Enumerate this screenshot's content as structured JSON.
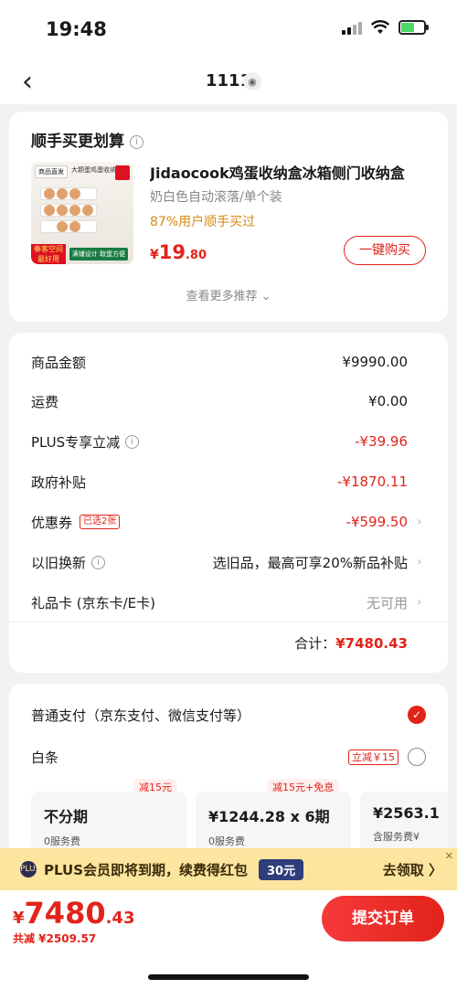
{
  "status_bar": {
    "time": "19:48"
  },
  "nav": {
    "title": "1111"
  },
  "upsell": {
    "section_title": "顺手买更划算",
    "thumb": {
      "top_tag": "商品直发",
      "top_text": "大颗蛋鸡蛋收纳盒",
      "left_tag": "秦客空间 最好用",
      "right_tag": "满铺设计 取蛋方便"
    },
    "product_name": "Jidaocook鸡蛋收纳盒冰箱侧门收纳盒",
    "product_spec": "奶白色自动滚落/单个装",
    "buyer_stat": "87%用户顺手买过",
    "price_symbol": "¥",
    "price_int": "19",
    "price_dec": ".80",
    "buy_label": "一键购买",
    "more_label": "查看更多推荐"
  },
  "summary": {
    "goods_label": "商品金额",
    "goods_value": "¥9990.00",
    "shipping_label": "运费",
    "shipping_value": "¥0.00",
    "plus_label": "PLUS专享立减",
    "plus_value": "-¥39.96",
    "gov_label": "政府补贴",
    "gov_value": "-¥1870.11",
    "coupon_label": "优惠券",
    "coupon_tag": "已选2张",
    "coupon_value": "-¥599.50",
    "tradein_label": "以旧换新",
    "tradein_value": "选旧品，最高可享20%新品补贴",
    "giftcard_label": "礼品卡 (京东卡/E卡)",
    "giftcard_value": "无可用",
    "total_label": "合计：",
    "total_value": "¥7480.43"
  },
  "payment": {
    "normal_label": "普通支付（京东支付、微信支付等）",
    "baitiao_label": "白条",
    "baitiao_tag": "立减￥15",
    "plans": [
      {
        "badge": "减15元",
        "title": "不分期",
        "sub": "0服务费"
      },
      {
        "badge": "减15元+免息",
        "title": "¥1244.28 x 6期",
        "sub": "0服务费"
      },
      {
        "badge": "",
        "title": "¥2563.1",
        "sub": "含服务费¥"
      }
    ]
  },
  "banner": {
    "icon_text": "PLUS",
    "text": "PLUS会员即将到期，续费得红包",
    "badge": "30元",
    "link": "去领取 〉"
  },
  "bottom": {
    "price_symbol": "¥",
    "price_int": "7480",
    "price_dec": ".43",
    "discount": "共减 ¥2509.57",
    "submit_label": "提交订单"
  },
  "colors": {
    "accent": "#e2231a",
    "banner": "#fce59e",
    "buyer_stat": "#d68a16"
  },
  "icons": {
    "back": "chevron-left-icon",
    "location": "location-pin-icon",
    "info": "info-circle-icon",
    "chevron": "chevron-right-icon",
    "check": "check-icon"
  }
}
